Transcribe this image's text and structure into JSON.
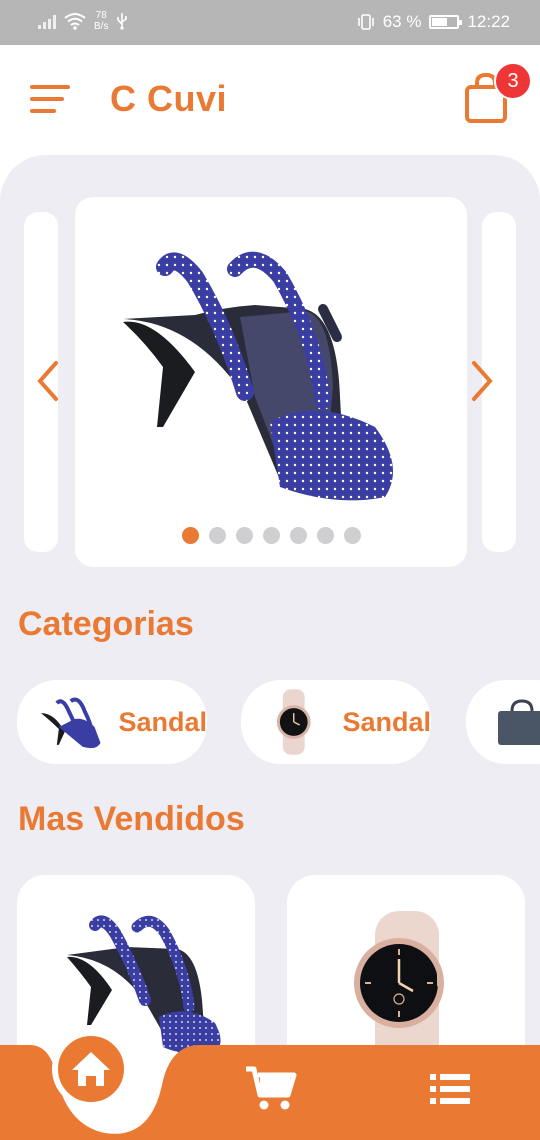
{
  "status_bar": {
    "net_speed": "78",
    "net_unit": "B/s",
    "battery": "63 %",
    "battery_level": 0.63,
    "time": "12:22"
  },
  "header": {
    "title": "C Cuvi",
    "cart_count": "3"
  },
  "carousel": {
    "slide_count": 7,
    "active_index": 0,
    "image": "blue-polka-dot-heeled-sandal"
  },
  "categories": {
    "title": "Categorias",
    "items": [
      {
        "label": "Sandal",
        "image": "sandal-thumbnail"
      },
      {
        "label": "Sandal",
        "image": "smartwatch-thumbnail"
      },
      {
        "label": "",
        "image": "laptop-bag-thumbnail"
      }
    ]
  },
  "best_sellers": {
    "title": "Mas Vendidos",
    "items": [
      {
        "image": "blue-polka-dot-heeled-sandal"
      },
      {
        "image": "rose-gold-smartwatch"
      }
    ]
  },
  "bottom_nav": {
    "items": [
      {
        "icon": "home-icon",
        "active": true
      },
      {
        "icon": "cart-icon",
        "active": false
      },
      {
        "icon": "list-icon",
        "active": false
      }
    ]
  },
  "colors": {
    "accent": "#ea7a33",
    "badge": "#ef3636",
    "panel": "#ededf3",
    "status_bar": "#b6b6b6"
  }
}
